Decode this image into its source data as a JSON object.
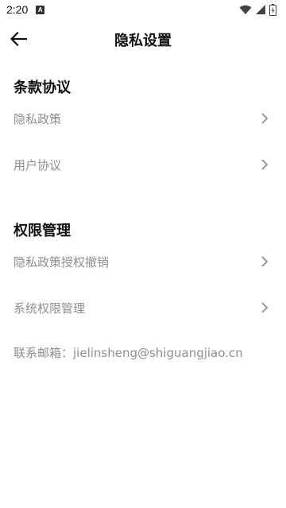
{
  "status_bar": {
    "time": "2:20",
    "app_notification": "A"
  },
  "header": {
    "title": "隐私设置"
  },
  "sections": [
    {
      "title": "条款协议",
      "items": [
        {
          "label": "隐私政策"
        },
        {
          "label": "用户协议"
        }
      ]
    },
    {
      "title": "权限管理",
      "items": [
        {
          "label": "隐私政策授权撤销"
        },
        {
          "label": "系统权限管理"
        }
      ]
    }
  ],
  "contact": {
    "text": "联系邮箱：jielinsheng@shiguangjiao.cn"
  },
  "icons": {
    "back": "arrow-left-icon",
    "chevron": "chevron-right-icon",
    "wifi": "wifi-icon",
    "signal": "signal-icon",
    "battery": "battery-icon"
  },
  "colors": {
    "background": "#ffffff",
    "title_text": "#111111",
    "item_text": "#8e8e8e",
    "chevron": "#8e8e8e"
  }
}
